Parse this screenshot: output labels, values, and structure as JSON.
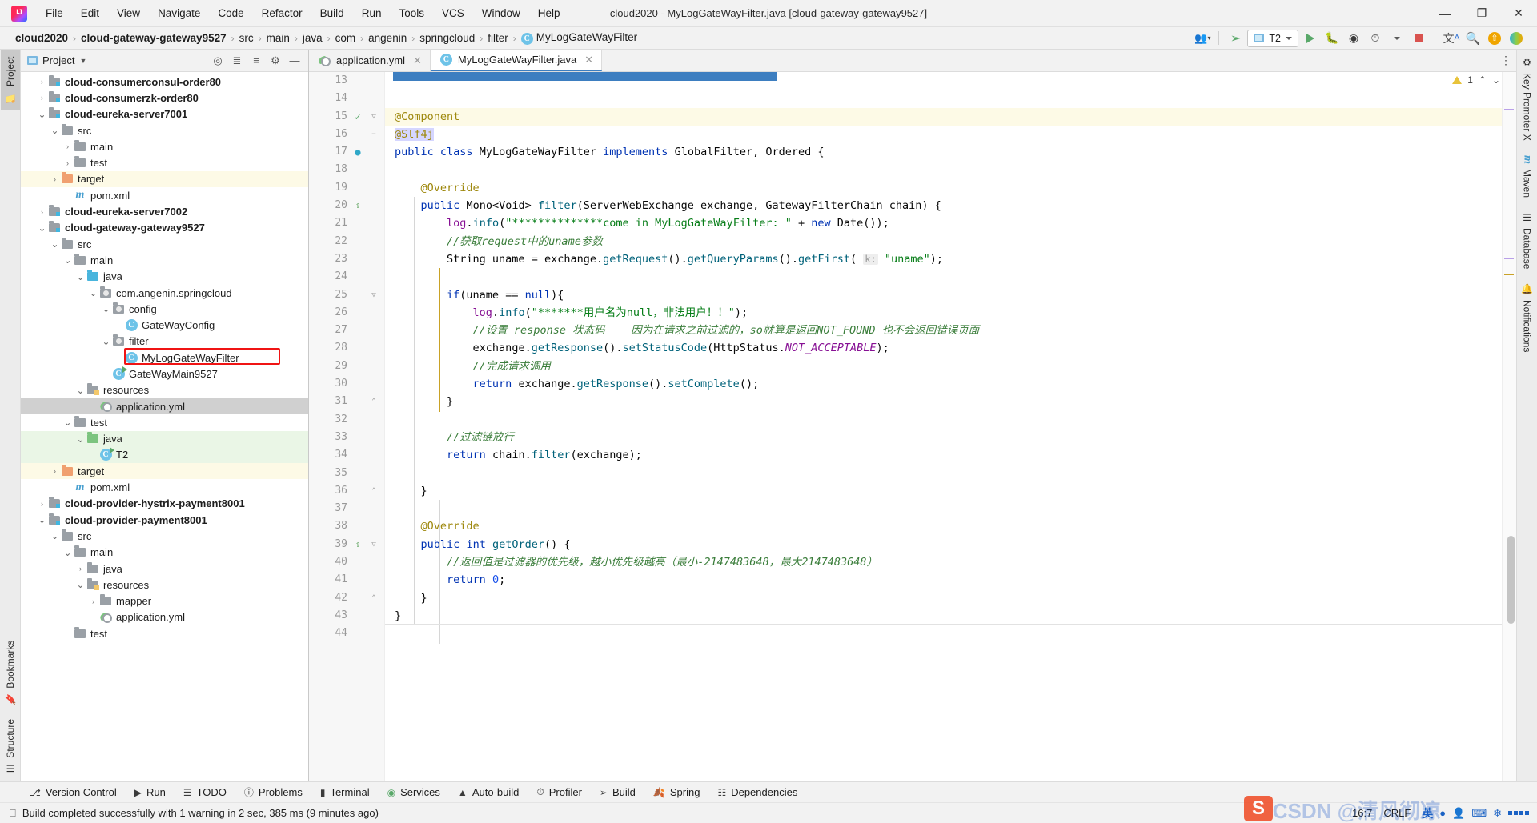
{
  "window": {
    "title": "cloud2020 - MyLogGateWayFilter.java [cloud-gateway-gateway9527]",
    "minimize": "—",
    "maximize": "❐",
    "close": "✕",
    "logo": "intellij-idea-logo"
  },
  "menu": [
    {
      "label": "File"
    },
    {
      "label": "Edit"
    },
    {
      "label": "View"
    },
    {
      "label": "Navigate"
    },
    {
      "label": "Code"
    },
    {
      "label": "Refactor"
    },
    {
      "label": "Build"
    },
    {
      "label": "Run"
    },
    {
      "label": "Tools"
    },
    {
      "label": "VCS"
    },
    {
      "label": "Window"
    },
    {
      "label": "Help"
    }
  ],
  "breadcrumb": {
    "items": [
      {
        "label": "cloud2020",
        "bold": true
      },
      {
        "label": "cloud-gateway-gateway9527",
        "bold": true
      },
      {
        "label": "src",
        "bold": false
      },
      {
        "label": "main",
        "bold": false
      },
      {
        "label": "java",
        "bold": false
      },
      {
        "label": "com",
        "bold": false
      },
      {
        "label": "angenin",
        "bold": false
      },
      {
        "label": "springcloud",
        "bold": false
      },
      {
        "label": "filter",
        "bold": false
      },
      {
        "label": "MyLogGateWayFilter",
        "bold": false,
        "badge": "C"
      }
    ],
    "separator": "›"
  },
  "toolbar": {
    "run_config": "T2",
    "icons": [
      "user-group-icon",
      "hammer-build-icon",
      "run-icon",
      "debug-icon",
      "run-with-coverage-icon",
      "profiler-icon",
      "stop-icon",
      "translate-icon",
      "search-icon",
      "update-icon",
      "idea-plugin-icon"
    ]
  },
  "left_tool_tabs": [
    {
      "label": "Project",
      "active": true,
      "icon": "folder-icon"
    },
    {
      "label": "Bookmarks",
      "active": false,
      "icon": "bookmark-icon"
    },
    {
      "label": "Structure",
      "active": false,
      "icon": "structure-icon"
    }
  ],
  "right_tool_tabs": [
    {
      "label": "Key Promoter X",
      "icon": "key-promoter-icon"
    },
    {
      "label": "Maven",
      "icon": "maven-icon"
    },
    {
      "label": "Database",
      "icon": "database-icon"
    },
    {
      "label": "Notifications",
      "icon": "bell-icon"
    }
  ],
  "project_panel": {
    "title": "Project",
    "header_icons": [
      "locate-icon",
      "expand-all-icon",
      "collapse-all-icon",
      "gear-icon",
      "hide-icon"
    ],
    "tree": [
      {
        "indent": 1,
        "arrow": "›",
        "icon": "module-folder",
        "label": "cloud-consumerconsul-order80",
        "bold": true,
        "hl": ""
      },
      {
        "indent": 1,
        "arrow": "›",
        "icon": "module-folder",
        "label": "cloud-consumerzk-order80",
        "bold": true,
        "hl": ""
      },
      {
        "indent": 1,
        "arrow": "⌄",
        "icon": "module-folder",
        "label": "cloud-eureka-server7001",
        "bold": true,
        "hl": ""
      },
      {
        "indent": 2,
        "arrow": "⌄",
        "icon": "gray-folder",
        "label": "src",
        "bold": false,
        "hl": ""
      },
      {
        "indent": 3,
        "arrow": "›",
        "icon": "gray-folder",
        "label": "main",
        "bold": false,
        "hl": ""
      },
      {
        "indent": 3,
        "arrow": "›",
        "icon": "gray-folder",
        "label": "test",
        "bold": false,
        "hl": ""
      },
      {
        "indent": 2,
        "arrow": "›",
        "icon": "orange-folder",
        "label": "target",
        "bold": false,
        "hl": "yellow"
      },
      {
        "indent": 3,
        "arrow": "",
        "icon": "maven-file",
        "label": "pom.xml",
        "bold": false,
        "hl": ""
      },
      {
        "indent": 1,
        "arrow": "›",
        "icon": "module-folder",
        "label": "cloud-eureka-server7002",
        "bold": true,
        "hl": ""
      },
      {
        "indent": 1,
        "arrow": "⌄",
        "icon": "module-folder",
        "label": "cloud-gateway-gateway9527",
        "bold": true,
        "hl": ""
      },
      {
        "indent": 2,
        "arrow": "⌄",
        "icon": "gray-folder",
        "label": "src",
        "bold": false,
        "hl": ""
      },
      {
        "indent": 3,
        "arrow": "⌄",
        "icon": "gray-folder",
        "label": "main",
        "bold": false,
        "hl": ""
      },
      {
        "indent": 4,
        "arrow": "⌄",
        "icon": "blue-folder",
        "label": "java",
        "bold": false,
        "hl": ""
      },
      {
        "indent": 5,
        "arrow": "⌄",
        "icon": "package-folder",
        "label": "com.angenin.springcloud",
        "bold": false,
        "hl": ""
      },
      {
        "indent": 6,
        "arrow": "⌄",
        "icon": "package-folder",
        "label": "config",
        "bold": false,
        "hl": ""
      },
      {
        "indent": 7,
        "arrow": "",
        "icon": "class-badge",
        "label": "GateWayConfig",
        "bold": false,
        "hl": ""
      },
      {
        "indent": 6,
        "arrow": "⌄",
        "icon": "package-folder",
        "label": "filter",
        "bold": false,
        "hl": ""
      },
      {
        "indent": 7,
        "arrow": "",
        "icon": "class-badge",
        "label": "MyLogGateWayFilter",
        "bold": false,
        "hl": "",
        "highlight_box": true
      },
      {
        "indent": 6,
        "arrow": "",
        "icon": "class-run-badge",
        "label": "GateWayMain9527",
        "bold": false,
        "hl": ""
      },
      {
        "indent": 4,
        "arrow": "⌄",
        "icon": "resources-folder",
        "label": "resources",
        "bold": false,
        "hl": ""
      },
      {
        "indent": 5,
        "arrow": "",
        "icon": "yml-file",
        "label": "application.yml",
        "bold": false,
        "hl": "selected"
      },
      {
        "indent": 3,
        "arrow": "⌄",
        "icon": "gray-folder",
        "label": "test",
        "bold": false,
        "hl": ""
      },
      {
        "indent": 4,
        "arrow": "⌄",
        "icon": "green-folder",
        "label": "java",
        "bold": false,
        "hl": "green"
      },
      {
        "indent": 5,
        "arrow": "",
        "icon": "class-run-badge",
        "label": "T2",
        "bold": false,
        "hl": "green"
      },
      {
        "indent": 2,
        "arrow": "›",
        "icon": "orange-folder",
        "label": "target",
        "bold": false,
        "hl": "yellow"
      },
      {
        "indent": 3,
        "arrow": "",
        "icon": "maven-file",
        "label": "pom.xml",
        "bold": false,
        "hl": ""
      },
      {
        "indent": 1,
        "arrow": "›",
        "icon": "module-folder",
        "label": "cloud-provider-hystrix-payment8001",
        "bold": true,
        "hl": ""
      },
      {
        "indent": 1,
        "arrow": "⌄",
        "icon": "module-folder",
        "label": "cloud-provider-payment8001",
        "bold": true,
        "hl": ""
      },
      {
        "indent": 2,
        "arrow": "⌄",
        "icon": "gray-folder",
        "label": "src",
        "bold": false,
        "hl": ""
      },
      {
        "indent": 3,
        "arrow": "⌄",
        "icon": "gray-folder",
        "label": "main",
        "bold": false,
        "hl": ""
      },
      {
        "indent": 4,
        "arrow": "›",
        "icon": "gray-folder",
        "label": "java",
        "bold": false,
        "hl": ""
      },
      {
        "indent": 4,
        "arrow": "⌄",
        "icon": "resources-folder",
        "label": "resources",
        "bold": false,
        "hl": ""
      },
      {
        "indent": 5,
        "arrow": "›",
        "icon": "gray-folder",
        "label": "mapper",
        "bold": false,
        "hl": ""
      },
      {
        "indent": 5,
        "arrow": "",
        "icon": "yml-file",
        "label": "application.yml",
        "bold": false,
        "hl": ""
      },
      {
        "indent": 3,
        "arrow": "",
        "icon": "gray-folder",
        "label": "test",
        "bold": false,
        "hl": ""
      }
    ]
  },
  "editor": {
    "tabs": [
      {
        "label": "application.yml",
        "icon": "yml-file",
        "active": false,
        "close": "✕"
      },
      {
        "label": "MyLogGateWayFilter.java",
        "icon": "class-badge",
        "active": true,
        "close": "✕"
      }
    ],
    "warning_count": "1",
    "warning_icon": "warning-triangle-icon",
    "nav_up": "⌃",
    "nav_down": "⌄",
    "first_line_number": 13,
    "lines": [
      {
        "n": 13,
        "gicon": "",
        "html": "<span class='plain'>   </span>",
        "partial": true
      },
      {
        "n": 14,
        "gicon": "",
        "html": ""
      },
      {
        "n": 15,
        "gicon": "bean-icon",
        "fold": "▽",
        "html": "<span class='ann'>@Component</span>"
      },
      {
        "n": 16,
        "gicon": "",
        "fold": "−",
        "hl": true,
        "html": "<span class='ann selmark'>@Slf4j</span>"
      },
      {
        "n": 17,
        "gicon": "bean-class-icon",
        "html": "<span class='kw'>public</span> <span class='kw'>class</span> <span class='plain'>MyLogGateWayFilter</span> <span class='kw'>implements</span> <span class='plain'>GlobalFilter, Ordered {</span>"
      },
      {
        "n": 18,
        "gicon": "",
        "html": ""
      },
      {
        "n": 19,
        "gicon": "",
        "html": "    <span class='ann'>@Override</span>"
      },
      {
        "n": 20,
        "gicon": "override-icon",
        "html": "    <span class='kw'>public</span> <span class='plain'>Mono&lt;Void&gt; </span><span class='fn'>filter</span><span class='plain'>(ServerWebExchange exchange, GatewayFilterChain chain) {</span>"
      },
      {
        "n": 21,
        "gicon": "",
        "html": "        <span class='fld'>log</span><span class='plain'>.</span><span class='fn'>info</span><span class='plain'>(</span><span class='str'>\"**************come in MyLogGateWayFilter: \"</span><span class='plain'> + </span><span class='kw'>new</span><span class='plain'> Date());</span>"
      },
      {
        "n": 22,
        "gicon": "",
        "html": "        <span class='cmtg'>//获取request中的uname参数</span>"
      },
      {
        "n": 23,
        "gicon": "",
        "html": "        <span class='plain'>String uname = exchange.</span><span class='fn'>getRequest</span><span class='plain'>().</span><span class='fn'>getQueryParams</span><span class='plain'>().</span><span class='fn'>getFirst</span><span class='plain'>( </span><span class='hint'>k:</span><span class='plain'> </span><span class='str'>\"uname\"</span><span class='plain'>);</span>"
      },
      {
        "n": 24,
        "gicon": "",
        "html": ""
      },
      {
        "n": 25,
        "gicon": "",
        "fold": "▽",
        "html": "        <span class='kw'>if</span><span class='plain'>(uname == </span><span class='kw'>null</span><span class='plain'>){</span>"
      },
      {
        "n": 26,
        "gicon": "",
        "html": "            <span class='fld'>log</span><span class='plain'>.</span><span class='fn'>info</span><span class='plain'>(</span><span class='str'>\"*******用户名为null，非法用户！！\"</span><span class='plain'>);</span>"
      },
      {
        "n": 27,
        "gicon": "",
        "html": "            <span class='cmtg'>//设置 response 状态码    因为在请求之前过滤的，so就算是返回NOT_FOUND 也不会返回错误页面</span>"
      },
      {
        "n": 28,
        "gicon": "",
        "html": "            <span class='plain'>exchange.</span><span class='fn'>getResponse</span><span class='plain'>().</span><span class='fn'>setStatusCode</span><span class='plain'>(HttpStatus.</span><span class='st'>NOT_ACCEPTABLE</span><span class='plain'>);</span>"
      },
      {
        "n": 29,
        "gicon": "",
        "html": "            <span class='cmtg'>//完成请求调用</span>"
      },
      {
        "n": 30,
        "gicon": "",
        "html": "            <span class='kw'>return</span><span class='plain'> exchange.</span><span class='fn'>getResponse</span><span class='plain'>().</span><span class='fn'>setComplete</span><span class='plain'>();</span>"
      },
      {
        "n": 31,
        "gicon": "",
        "fold": "⌃",
        "html": "        <span class='plain'>}</span>"
      },
      {
        "n": 32,
        "gicon": "",
        "html": ""
      },
      {
        "n": 33,
        "gicon": "",
        "html": "        <span class='cmtg'>//过滤链放行</span>"
      },
      {
        "n": 34,
        "gicon": "",
        "html": "        <span class='kw'>return</span><span class='plain'> chain.</span><span class='fn'>filter</span><span class='plain'>(exchange);</span>"
      },
      {
        "n": 35,
        "gicon": "",
        "html": ""
      },
      {
        "n": 36,
        "gicon": "",
        "fold": "⌃",
        "html": "    <span class='plain'>}</span>"
      },
      {
        "n": 37,
        "gicon": "",
        "html": ""
      },
      {
        "n": 38,
        "gicon": "",
        "html": "    <span class='ann'>@Override</span>"
      },
      {
        "n": 39,
        "gicon": "override-icon",
        "fold": "▽",
        "html": "    <span class='kw'>public</span> <span class='kw'>int</span> <span class='fn'>getOrder</span><span class='plain'>() {</span>"
      },
      {
        "n": 40,
        "gicon": "",
        "html": "        <span class='cmtg'>//返回值是过滤器的优先级，越小优先级越高（最小-2147483648，最大2147483648）</span>"
      },
      {
        "n": 41,
        "gicon": "",
        "html": "        <span class='kw'>return</span><span class='plain'> </span><span class='num'>0</span><span class='plain'>;</span>"
      },
      {
        "n": 42,
        "gicon": "",
        "fold": "⌃",
        "html": "    <span class='plain'>}</span>"
      },
      {
        "n": 43,
        "gicon": "",
        "html": "<span class='plain'>}</span>"
      },
      {
        "n": 44,
        "gicon": "",
        "html": ""
      }
    ]
  },
  "bottom_toolbar": [
    {
      "label": "Version Control",
      "icon": "branch-icon"
    },
    {
      "label": "Run",
      "icon": "run-icon"
    },
    {
      "label": "TODO",
      "icon": "todo-list-icon"
    },
    {
      "label": "Problems",
      "icon": "problems-icon"
    },
    {
      "label": "Terminal",
      "icon": "terminal-icon"
    },
    {
      "label": "Services",
      "icon": "services-icon"
    },
    {
      "label": "Auto-build",
      "icon": "auto-build-icon"
    },
    {
      "label": "Profiler",
      "icon": "profiler-icon"
    },
    {
      "label": "Build",
      "icon": "hammer-build-icon"
    },
    {
      "label": "Spring",
      "icon": "spring-leaf-icon"
    },
    {
      "label": "Dependencies",
      "icon": "dependencies-icon"
    }
  ],
  "statusbar": {
    "message": "Build completed successfully with 1 warning in 2 sec, 385 ms (9 minutes ago)",
    "message_icon": "console-icon",
    "caret_position": "16:7",
    "line_separator": "CRLF",
    "ime_label": "英",
    "watermark": "CSDN @清风彻凉"
  },
  "colors": {
    "accent_blue": "#3d7ec0",
    "keyword": "#0033b3",
    "string": "#067d17",
    "comment_green": "#3a7d3a",
    "annotation": "#9e880d",
    "highlight_red": "#f01414",
    "selected_row": "#d0d0d0"
  }
}
